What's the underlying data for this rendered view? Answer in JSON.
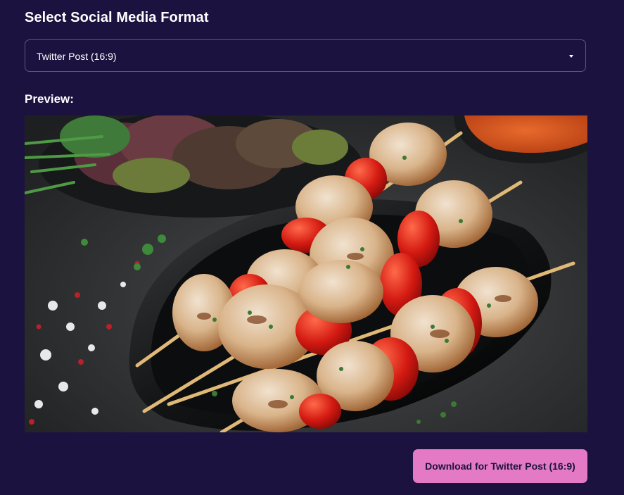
{
  "header": {
    "title": "Select Social Media Format"
  },
  "format_select": {
    "selected": "Twitter Post (16:9)",
    "caret_icon": "caret-down-icon"
  },
  "preview": {
    "label": "Preview:",
    "image_subject": "grilled chicken and red pepper skewers on a black plate"
  },
  "actions": {
    "download_label": "Download for Twitter Post (16:9)"
  },
  "colors": {
    "background": "#1c1240",
    "accent_button": "#e47ac6",
    "border": "#5c5580"
  }
}
